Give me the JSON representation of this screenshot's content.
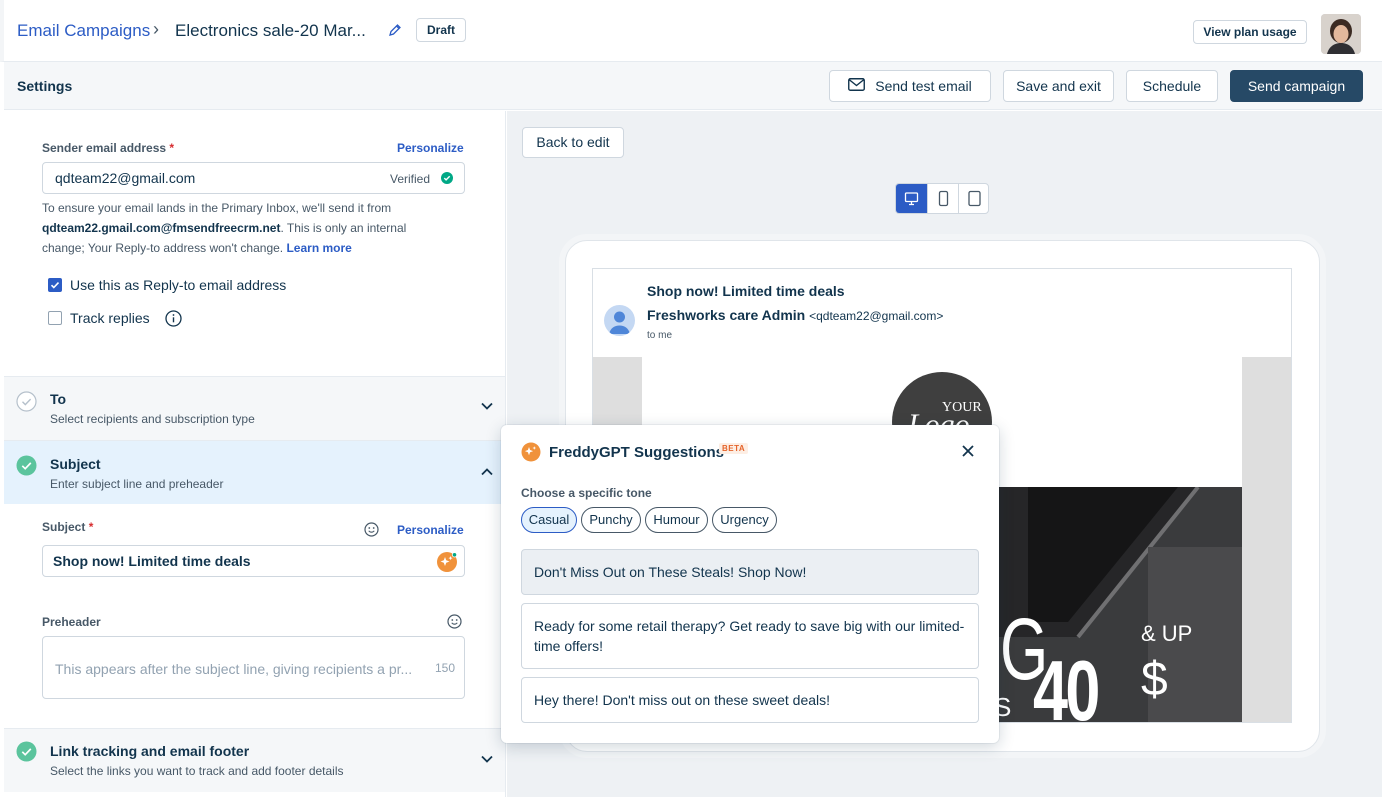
{
  "header": {
    "breadcrumb_root": "Email Campaigns",
    "separator": "›",
    "campaign_name": "Electronics sale-20 Mar...",
    "status_badge": "Draft",
    "plan_usage_button": "View plan usage"
  },
  "toolbar": {
    "title": "Settings",
    "send_test_label": "Send test email",
    "save_exit_label": "Save and exit",
    "schedule_label": "Schedule",
    "send_campaign_label": "Send campaign"
  },
  "sender": {
    "label": "Sender email address",
    "required_mark": "*",
    "personalize_label": "Personalize",
    "email_value": "qdteam22@gmail.com",
    "verified_label": "Verified",
    "help_prefix": "To ensure your email lands in the Primary Inbox, we'll send it from",
    "help_email": "qdteam22.gmail.com@fmsendfreecrm.net",
    "help_mid": ". This is only an internal",
    "help_suffix": "change; Your Reply-to address won't change.",
    "learn_more": "Learn more",
    "reply_to_label": "Use this as Reply-to email address",
    "reply_to_checked": true,
    "track_replies_label": "Track replies",
    "track_replies_checked": false
  },
  "sections": {
    "to": {
      "title": "To",
      "desc": "Select recipients and subscription type"
    },
    "subject": {
      "title": "Subject",
      "desc": "Enter subject line and preheader"
    },
    "link": {
      "title": "Link tracking and email footer",
      "desc": "Select the links you want to track and add footer details"
    }
  },
  "subject_form": {
    "subject_label": "Subject",
    "required_mark": "*",
    "personalize_label": "Personalize",
    "subject_value": "Shop now! Limited time deals",
    "preheader_label": "Preheader",
    "preheader_placeholder": "This appears after the subject line, giving recipients a pr...",
    "preheader_count": "150"
  },
  "preview": {
    "back_label": "Back to edit",
    "subject": "Shop now! Limited time deals",
    "sender_name": "Freshworks care Admin",
    "sender_email": "<qdteam22@gmail.com>",
    "to_me": "to me",
    "logo_line1": "YOUR",
    "logo_line2": "Logo",
    "banner_letter": "G",
    "banner_number": "40",
    "banner_up": "& UP",
    "banner_dollar": "$",
    "banner_s": "S"
  },
  "freddy": {
    "title": "FreddyGPT Suggestions",
    "beta": "BETA",
    "tone_label": "Choose a specific tone",
    "tones": [
      "Casual",
      "Punchy",
      "Humour",
      "Urgency"
    ],
    "selected_tone": "Casual",
    "suggestions": [
      "Don't Miss Out on These Steals! Shop Now!",
      "Ready for some retail therapy? Get ready to save big with our limited-time offers!",
      "Hey there! Don't miss out on these sweet deals!"
    ]
  },
  "colors": {
    "primary_link": "#2c5cc5",
    "dark_button": "#264966",
    "success_green": "#00a886",
    "freddy_orange": "#f0923b"
  }
}
